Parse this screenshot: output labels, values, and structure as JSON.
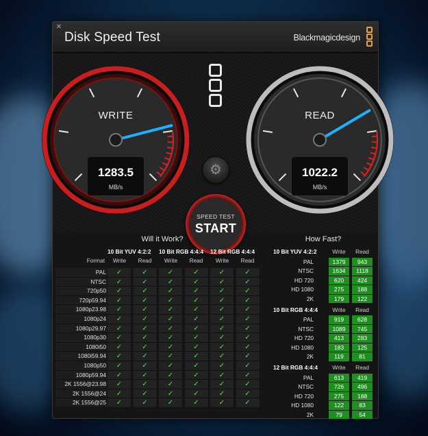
{
  "window": {
    "close_glyph": "✕",
    "title": "Disk Speed Test",
    "brand": "Blackmagicdesign"
  },
  "gauges": {
    "write": {
      "label": "WRITE",
      "value": "1283.5",
      "unit": "MB/s",
      "level": 0.78
    },
    "read": {
      "label": "READ",
      "value": "1022.2",
      "unit": "MB/s",
      "level": 0.72
    }
  },
  "controls": {
    "settings_icon": "gear-icon",
    "start_small": "SPEED TEST",
    "start_big": "START"
  },
  "will_it_work": {
    "heading": "Will it Work?",
    "format_header": "Format",
    "groups": [
      "10 Bit YUV 4:2:2",
      "10 Bit RGB 4:4:4",
      "12 Bit RGB 4:4:4"
    ],
    "write_label": "Write",
    "read_label": "Read",
    "check_glyph": "✓",
    "formats": [
      "PAL",
      "NTSC",
      "720p50",
      "720p59.94",
      "1080p23.98",
      "1080p24",
      "1080p29.97",
      "1080p30",
      "1080i50",
      "1080i59.94",
      "1080p50",
      "1080p59.94",
      "2K 1556@23.98",
      "2K 1556@24",
      "2K 1556@25"
    ]
  },
  "how_fast": {
    "heading": "How Fast?",
    "write_label": "Write",
    "read_label": "Read",
    "groups": [
      {
        "title": "10 Bit YUV 4:2:2",
        "rows": [
          {
            "name": "PAL",
            "write": "1379",
            "read": "943"
          },
          {
            "name": "NTSC",
            "write": "1634",
            "read": "1118"
          },
          {
            "name": "HD 720",
            "write": "620",
            "read": "424"
          },
          {
            "name": "HD 1080",
            "write": "275",
            "read": "188"
          },
          {
            "name": "2K",
            "write": "179",
            "read": "122"
          }
        ]
      },
      {
        "title": "10 Bit RGB 4:4:4",
        "rows": [
          {
            "name": "PAL",
            "write": "919",
            "read": "628"
          },
          {
            "name": "NTSC",
            "write": "1089",
            "read": "745"
          },
          {
            "name": "HD 720",
            "write": "413",
            "read": "283"
          },
          {
            "name": "HD 1080",
            "write": "183",
            "read": "125"
          },
          {
            "name": "2K",
            "write": "119",
            "read": "81"
          }
        ]
      },
      {
        "title": "12 Bit RGB 4:4:4",
        "rows": [
          {
            "name": "PAL",
            "write": "613",
            "read": "419"
          },
          {
            "name": "NTSC",
            "write": "726",
            "read": "496"
          },
          {
            "name": "HD 720",
            "write": "275",
            "read": "188"
          },
          {
            "name": "HD 1080",
            "write": "122",
            "read": "83"
          },
          {
            "name": "2K",
            "write": "79",
            "read": "54"
          }
        ]
      }
    ]
  },
  "colors": {
    "write_ring": "#c81e1e",
    "read_ring": "#bdbdbd",
    "needle": "#19b4ff",
    "check": "#55e055",
    "value_box": "#1f8f1f"
  }
}
